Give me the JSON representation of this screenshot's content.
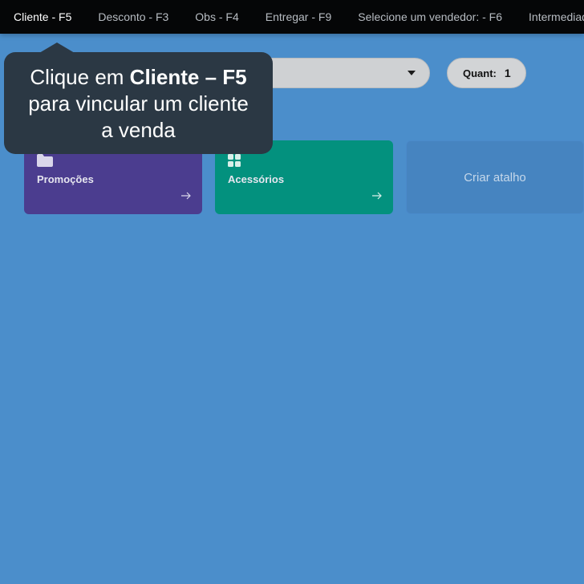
{
  "topbar": {
    "items": [
      {
        "label": "Cliente - F5"
      },
      {
        "label": "Desconto - F3"
      },
      {
        "label": "Obs - F4"
      },
      {
        "label": "Entregar - F9"
      },
      {
        "label": "Selecione um vendedor: - F6"
      },
      {
        "label": "Intermediador"
      }
    ]
  },
  "quant": {
    "label": "Quant:",
    "value": "1"
  },
  "cards": {
    "promocoes": {
      "label": "Promoções",
      "icon": "folder-icon"
    },
    "acessorios": {
      "label": "Acessórios",
      "icon": "grid-icon"
    },
    "criar": {
      "label": "Criar atalho"
    }
  },
  "tooltip": {
    "prefix": "Clique em ",
    "bold": "Cliente – F5",
    "line2": "para vincular um cliente",
    "line3": "a venda"
  },
  "colors": {
    "background": "#4b8ecb",
    "topbar": "#050607",
    "promocoes": "#4b3d8f",
    "acessorios": "#03917e",
    "tooltip": "#2b3844"
  }
}
